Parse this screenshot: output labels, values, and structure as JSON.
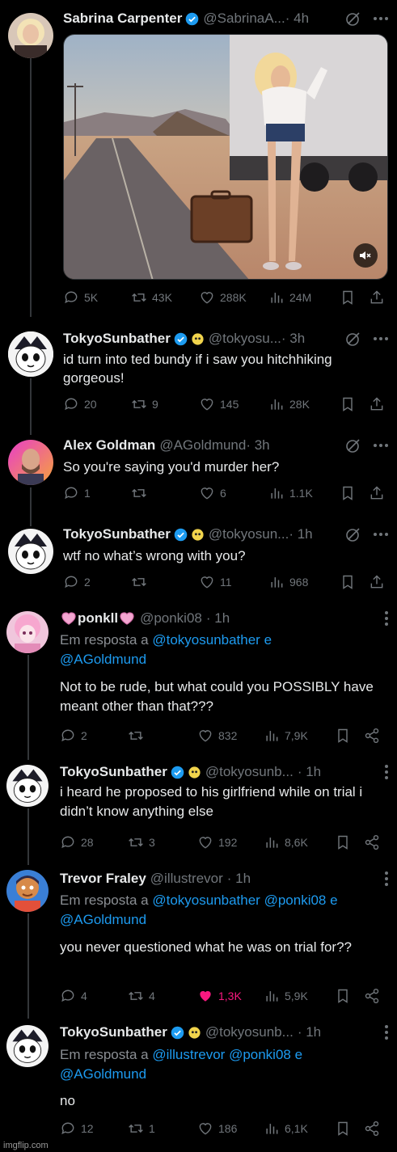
{
  "tweets": [
    {
      "name": "Sabrina Carpenter",
      "handle": "@SabrinaA...",
      "time": "· 4h",
      "stats": {
        "replies": "5K",
        "retweets": "43K",
        "likes": "288K",
        "views": "24M"
      }
    },
    {
      "name": "TokyoSunbather",
      "handle": "@tokyosu...",
      "time": "· 3h",
      "text": "id turn into ted bundy if i saw you hitchhiking gorgeous!",
      "stats": {
        "replies": "20",
        "retweets": "9",
        "likes": "145",
        "views": "28K"
      }
    },
    {
      "name": "Alex Goldman",
      "handle": "@AGoldmund",
      "time": "· 3h",
      "text": "So you're saying you'd murder her?",
      "stats": {
        "replies": "1",
        "retweets": "",
        "likes": "6",
        "views": "1.1K"
      }
    },
    {
      "name": "TokyoSunbather",
      "handle": "@tokyosun...",
      "time": "· 1h",
      "text": "wtf no what’s wrong with you?",
      "stats": {
        "replies": "2",
        "retweets": "",
        "likes": "11",
        "views": "968"
      }
    },
    {
      "name": "ponkll",
      "handle": "@ponki08",
      "time": "· 1h",
      "reply_prefix": "Em resposta a",
      "reply_links": "@tokyosunbather e",
      "reply_links2": "@AGoldmund",
      "text": "Not to be rude, but what could you POSSIBLY have meant other than that???",
      "stats": {
        "replies": "2",
        "retweets": "",
        "likes": "832",
        "views": "7,9K"
      }
    },
    {
      "name": "TokyoSunbather",
      "handle": "@tokyosunb...",
      "time": "· 1h",
      "text": "i heard he proposed to his girlfriend while on trial i didn’t know anything else",
      "stats": {
        "replies": "28",
        "retweets": "3",
        "likes": "192",
        "views": "8,6K"
      }
    },
    {
      "name": "Trevor Fraley",
      "handle": "@illustrevor",
      "time": "· 1h",
      "reply_prefix": "Em resposta a",
      "reply_links": "@tokyosunbather @ponki08 e",
      "reply_links2": "@AGoldmund",
      "text": "you never questioned what he was on trial for??",
      "stats": {
        "replies": "4",
        "retweets": "4",
        "likes": "1,3K",
        "views": "5,9K"
      }
    },
    {
      "name": "TokyoSunbather",
      "handle": "@tokyosunb...",
      "time": "· 1h",
      "reply_prefix": "Em resposta a",
      "reply_links": "@illustrevor @ponki08 e",
      "reply_links2": "@AGoldmund",
      "text": "no",
      "stats": {
        "replies": "12",
        "retweets": "1",
        "likes": "186",
        "views": "6,1K"
      }
    }
  ],
  "watermark": "imgflip.com",
  "colors": {
    "background": "#000000",
    "text": "#e7e9ea",
    "muted": "#71767b",
    "link": "#1d9bf0",
    "verified": "#1d9bf0",
    "like_active": "#f91880"
  }
}
